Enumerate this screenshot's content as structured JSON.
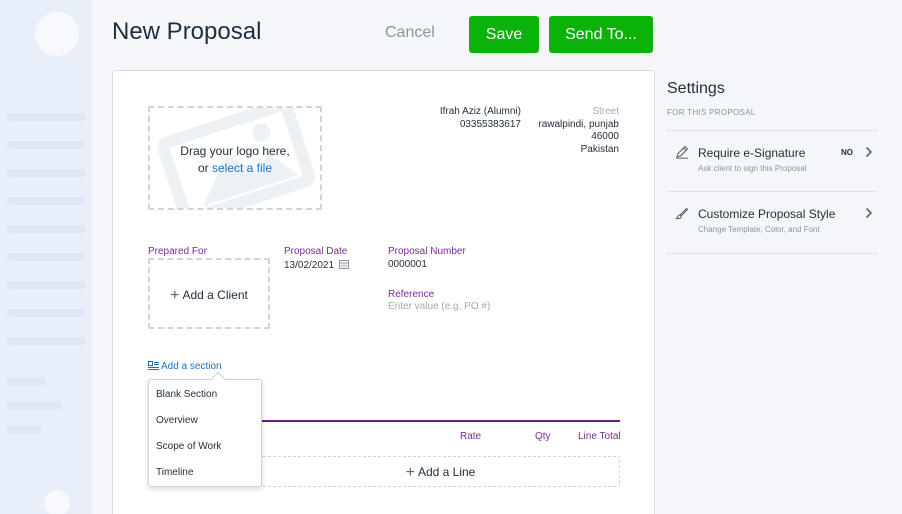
{
  "header": {
    "title": "New Proposal",
    "cancel_label": "Cancel",
    "save_label": "Save",
    "send_label": "Send To..."
  },
  "document": {
    "logo_line1": "Drag your logo here,",
    "logo_line2_prefix": "or",
    "logo_line2_link": "select a file",
    "sender_name": "Ifrah Aziz (Alumni)",
    "sender_phone": "03355383617",
    "address_street_placeholder": "Street",
    "address_city": "rawalpindi,  punjab",
    "address_zip": "46000",
    "address_country": "Pakistan",
    "prepared_for_label": "Prepared For",
    "add_client_label": "Add a Client",
    "proposal_date_label": "Proposal Date",
    "proposal_date_value": "13/02/2021",
    "proposal_number_label": "Proposal Number",
    "proposal_number_value": "0000001",
    "reference_label": "Reference",
    "reference_placeholder": "Enter value (e.g. PO #)",
    "add_section_label": "Add a section",
    "section_menu": [
      "Blank Section",
      "Overview",
      "Scope of Work",
      "Timeline"
    ],
    "columns": {
      "rate": "Rate",
      "qty": "Qty",
      "line_total": "Line Total"
    },
    "add_line_label": "Add a Line"
  },
  "settings": {
    "title": "Settings",
    "subtitle": "FOR THIS PROPOSAL",
    "items": [
      {
        "name": "Require e-Signature",
        "desc": "Ask client to sign this Proposal",
        "value": "NO",
        "icon": "pen-icon"
      },
      {
        "name": "Customize Proposal Style",
        "desc": "Change Template, Color, and Font",
        "value": "",
        "icon": "brush-icon"
      }
    ]
  },
  "colors": {
    "primary_green": "#0ab20a",
    "accent_purple": "#7a2a96",
    "link_blue": "#1a73c9"
  }
}
